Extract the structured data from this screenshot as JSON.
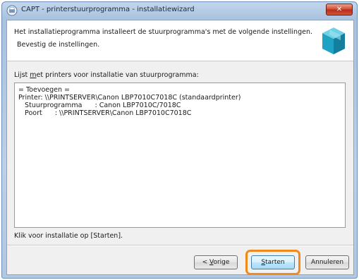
{
  "window": {
    "title": "CAPT - printerstuurprogramma - installatiewizard",
    "close_label": "✕"
  },
  "header": {
    "line1": "Het installatieprogramma installeert de stuurprogramma's met de volgende instellingen.",
    "line2": "Bevestig de instellingen."
  },
  "list": {
    "label_prefix": "Lijst ",
    "label_underlined": "m",
    "label_suffix": "et printers voor installatie van stuurprogramma:",
    "lines": [
      "= Toevoegen =",
      "Printer: \\\\PRINTSERVER\\Canon LBP7010C7018C (standaardprinter)",
      "   Stuurprogramma      : Canon LBP7010C/7018C",
      "   Poort      : \\\\PRINTSERVER\\Canon LBP7010C7018C"
    ]
  },
  "footer": {
    "instruction": "Klik voor installatie op [Starten]."
  },
  "buttons": {
    "back_prefix": "< ",
    "back_underlined": "V",
    "back_suffix": "orige",
    "start_underlined": "S",
    "start_suffix": "tarten",
    "cancel_label": "Annuleren"
  },
  "colors": {
    "highlight": "#f08a1c"
  }
}
